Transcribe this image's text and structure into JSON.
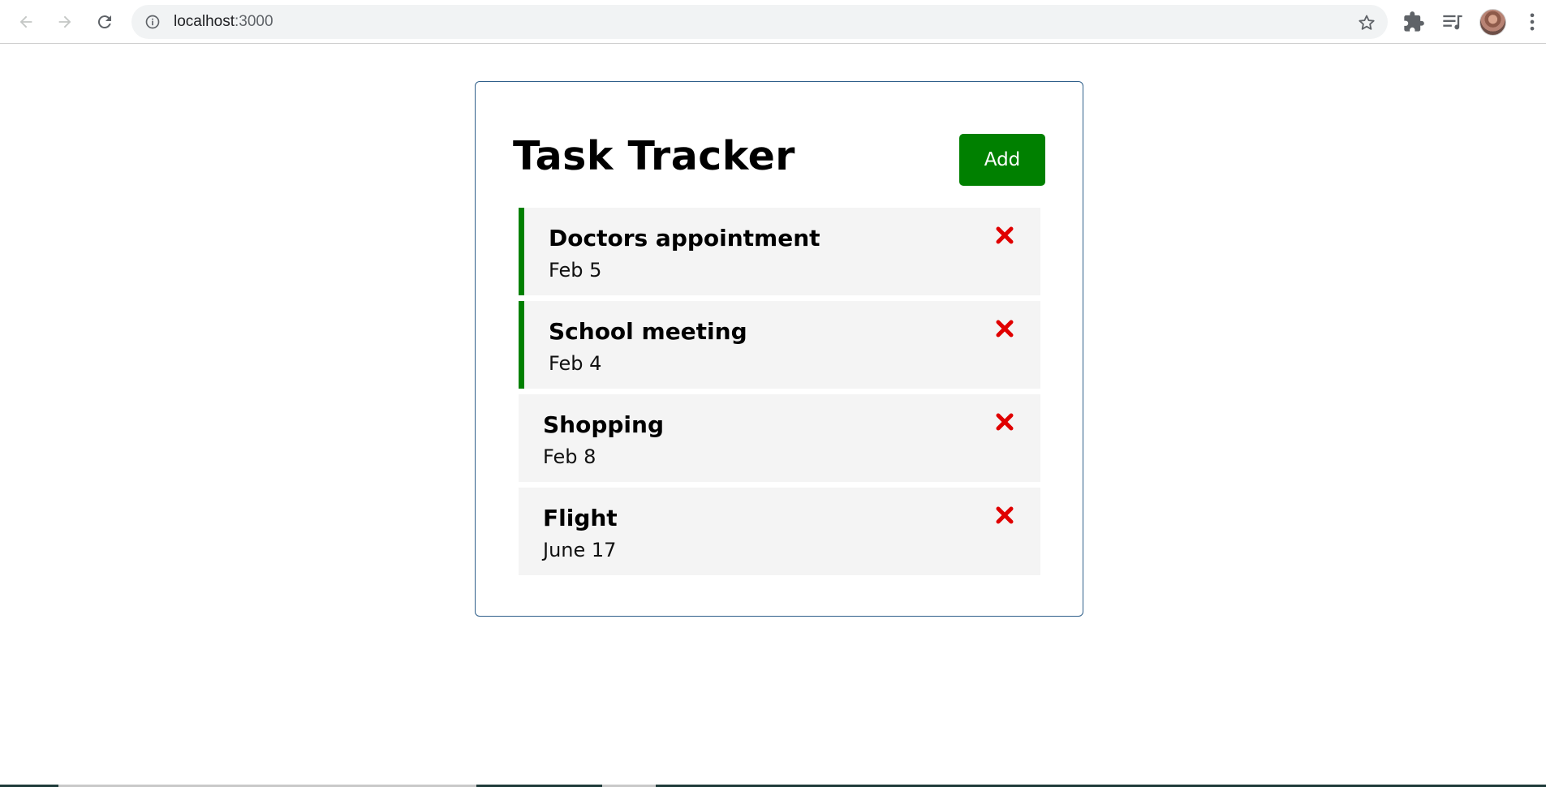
{
  "browser": {
    "url_host": "localhost",
    "url_port": ":3000",
    "icons": {
      "back": "arrow-left-icon",
      "forward": "arrow-right-icon",
      "reload": "reload-icon",
      "info": "info-icon",
      "bookmark": "star-icon",
      "extensions": "puzzle-icon",
      "media": "media-queue-icon",
      "menu": "kebab-menu-icon"
    }
  },
  "app": {
    "title": "Task Tracker",
    "add_label": "Add",
    "colors": {
      "accent": "#008000",
      "delete": "#e00000",
      "task_bg": "#f4f4f4"
    },
    "tasks": [
      {
        "name": "Doctors appointment",
        "day": "Feb 5",
        "reminder": true
      },
      {
        "name": "School meeting",
        "day": "Feb 4",
        "reminder": true
      },
      {
        "name": "Shopping",
        "day": "Feb 8",
        "reminder": false
      },
      {
        "name": "Flight",
        "day": "June 17",
        "reminder": false
      }
    ]
  }
}
